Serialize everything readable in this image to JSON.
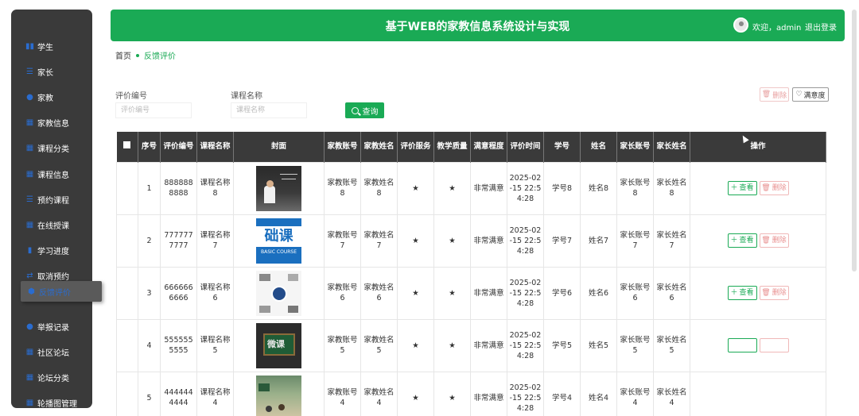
{
  "header": {
    "title": "基于WEB的家教信息系统设计与实现",
    "welcome": "欢迎，admin",
    "logout": "退出登录"
  },
  "breadcrumb": {
    "home": "首页",
    "current": "反馈评价"
  },
  "sidebar": {
    "items": [
      {
        "label": "学生",
        "icon": "users-icon"
      },
      {
        "label": "家长",
        "icon": "list-icon"
      },
      {
        "label": "家教",
        "icon": "user-icon"
      },
      {
        "label": "家教信息",
        "icon": "grid-icon"
      },
      {
        "label": "课程分类",
        "icon": "grid-icon"
      },
      {
        "label": "课程信息",
        "icon": "grid-icon"
      },
      {
        "label": "预约课程",
        "icon": "sliders-icon"
      },
      {
        "label": "在线授课",
        "icon": "grid-icon"
      },
      {
        "label": "学习进度",
        "icon": "bar-chart-icon"
      },
      {
        "label": "取消预约",
        "icon": "exchange-icon"
      },
      {
        "label": "反馈评价",
        "icon": "shield-icon"
      },
      {
        "label": "举报记录",
        "icon": "user-icon"
      },
      {
        "label": "社区论坛",
        "icon": "grid-icon"
      },
      {
        "label": "论坛分类",
        "icon": "grid-icon"
      },
      {
        "label": "轮播图管理",
        "icon": "grid-icon"
      }
    ]
  },
  "search": {
    "field1_label": "评价编号",
    "field1_placeholder": "评价编号",
    "field2_label": "课程名称",
    "field2_placeholder": "课程名称",
    "button": "查询"
  },
  "actions": {
    "delete": "删除",
    "satisfaction": "满意度"
  },
  "table": {
    "headers": [
      "序号",
      "评价编号",
      "课程名称",
      "封面",
      "家教账号",
      "家教姓名",
      "评价服务",
      "教学质量",
      "满意程度",
      "评价时间",
      "学号",
      "姓名",
      "家长账号",
      "家长姓名",
      "操作"
    ],
    "view_label": "查看",
    "delete_label": "删除",
    "rows": [
      {
        "no": "1",
        "code": "8888888888",
        "course": "课程名称8",
        "tutor_account": "家教账号8",
        "tutor_name": "家教姓名8",
        "service": "★",
        "quality": "★",
        "satisfaction": "非常满意",
        "time": "2025-02-15 22:54:28",
        "student_no": "学号8",
        "name": "姓名8",
        "parent_account": "家长账号8",
        "parent_name": "家长姓名8"
      },
      {
        "no": "2",
        "code": "7777777777",
        "course": "课程名称7",
        "tutor_account": "家教账号7",
        "tutor_name": "家教姓名7",
        "service": "★",
        "quality": "★",
        "satisfaction": "非常满意",
        "time": "2025-02-15 22:54:28",
        "student_no": "学号7",
        "name": "姓名7",
        "parent_account": "家长账号7",
        "parent_name": "家长姓名7"
      },
      {
        "no": "3",
        "code": "6666666666",
        "course": "课程名称6",
        "tutor_account": "家教账号6",
        "tutor_name": "家教姓名6",
        "service": "★",
        "quality": "★",
        "satisfaction": "非常满意",
        "time": "2025-02-15 22:54:28",
        "student_no": "学号6",
        "name": "姓名6",
        "parent_account": "家长账号6",
        "parent_name": "家长姓名6"
      },
      {
        "no": "4",
        "code": "5555555555",
        "course": "课程名称5",
        "tutor_account": "家教账号5",
        "tutor_name": "家教姓名5",
        "service": "★",
        "quality": "★",
        "satisfaction": "非常满意",
        "time": "2025-02-15 22:54:28",
        "student_no": "学号5",
        "name": "姓名5",
        "parent_account": "家长账号5",
        "parent_name": "家长姓名5"
      },
      {
        "no": "5",
        "code": "4444444444",
        "course": "课程名称4",
        "tutor_account": "家教账号4",
        "tutor_name": "家教姓名4",
        "service": "★",
        "quality": "★",
        "satisfaction": "非常满意",
        "time": "2025-02-15 22:54:28",
        "student_no": "学号4",
        "name": "姓名4",
        "parent_account": "家长账号4",
        "parent_name": "家长姓名4"
      }
    ]
  },
  "cover_text": {
    "row2_a": "础课",
    "row2_b": "BASIC COURSE",
    "row4": "微课"
  },
  "colors": {
    "accent": "#1aaa55",
    "sidebar": "#3a3a3a",
    "danger": "#e89090"
  }
}
